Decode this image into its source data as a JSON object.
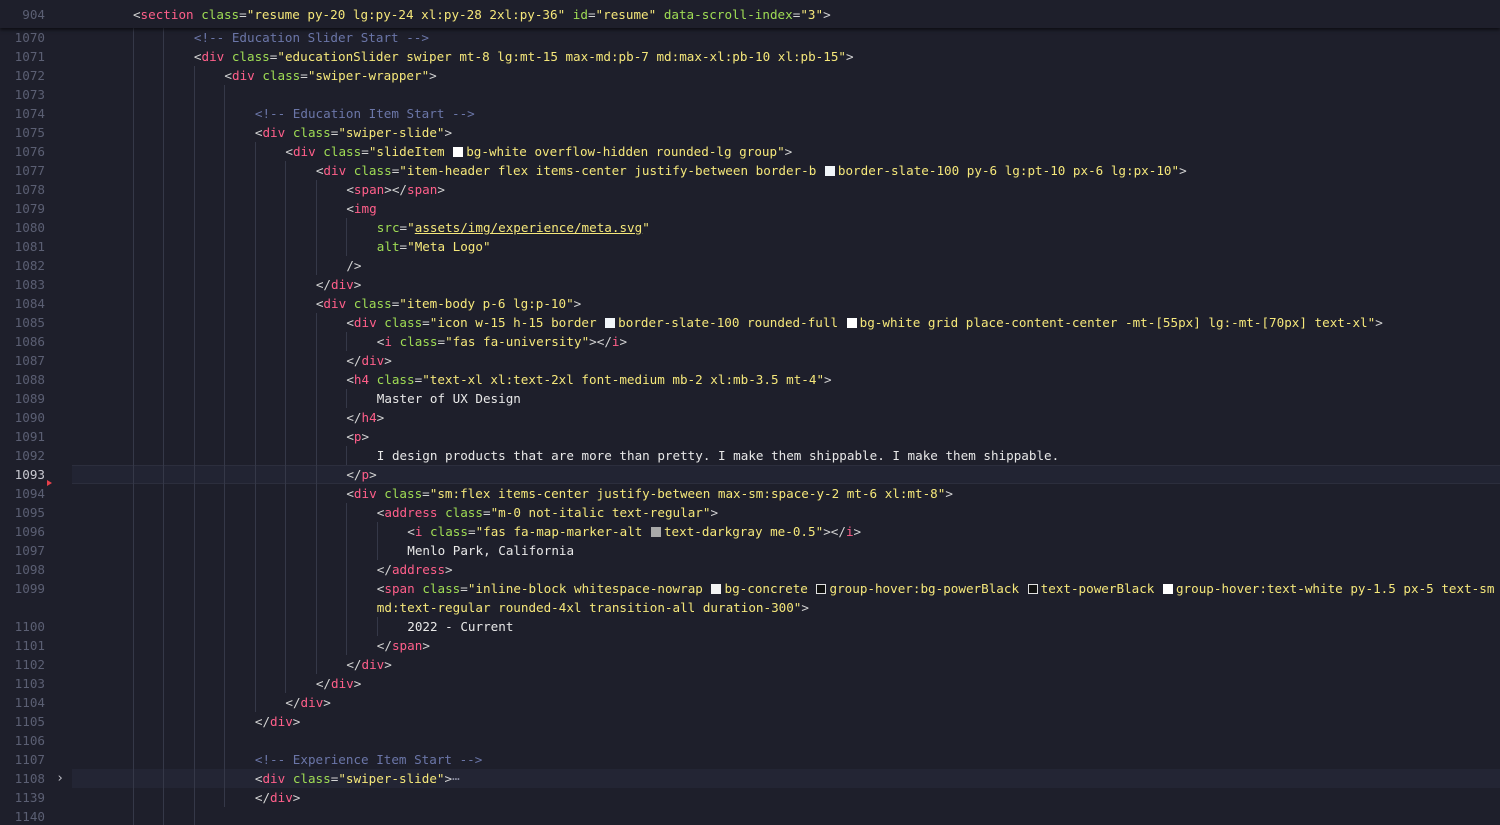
{
  "editor": {
    "sticky": {
      "line_number": "904",
      "code": [
        {
          "k": "p",
          "v": "<"
        },
        {
          "k": "t",
          "v": "section"
        },
        {
          "k": "p",
          "v": " "
        },
        {
          "k": "a",
          "v": "class"
        },
        {
          "k": "p",
          "v": "="
        },
        {
          "k": "s",
          "v": "\"resume py-20 lg:py-24 xl:py-28 2xl:py-36\""
        },
        {
          "k": "p",
          "v": " "
        },
        {
          "k": "a",
          "v": "id"
        },
        {
          "k": "p",
          "v": "="
        },
        {
          "k": "s",
          "v": "\"resume\""
        },
        {
          "k": "p",
          "v": " "
        },
        {
          "k": "a",
          "v": "data-scroll-index"
        },
        {
          "k": "p",
          "v": "="
        },
        {
          "k": "s",
          "v": "\"3\""
        },
        {
          "k": "p",
          "v": ">"
        }
      ]
    },
    "lines": [
      {
        "ln": "1070",
        "indent": 4,
        "code": [
          {
            "k": "c",
            "v": "<!-- Education Slider Start -->"
          }
        ]
      },
      {
        "ln": "1071",
        "indent": 4,
        "code": [
          {
            "k": "p",
            "v": "<"
          },
          {
            "k": "t",
            "v": "div"
          },
          {
            "k": "p",
            "v": " "
          },
          {
            "k": "a",
            "v": "class"
          },
          {
            "k": "p",
            "v": "="
          },
          {
            "k": "s",
            "v": "\"educationSlider swiper mt-8 lg:mt-15 max-md:pb-7 md:max-xl:pb-10 xl:pb-15\""
          },
          {
            "k": "p",
            "v": ">"
          }
        ]
      },
      {
        "ln": "1072",
        "indent": 5,
        "code": [
          {
            "k": "p",
            "v": "<"
          },
          {
            "k": "t",
            "v": "div"
          },
          {
            "k": "p",
            "v": " "
          },
          {
            "k": "a",
            "v": "class"
          },
          {
            "k": "p",
            "v": "="
          },
          {
            "k": "s",
            "v": "\"swiper-wrapper\""
          },
          {
            "k": "p",
            "v": ">"
          }
        ]
      },
      {
        "ln": "1073",
        "indent": 6,
        "code": []
      },
      {
        "ln": "1074",
        "indent": 6,
        "code": [
          {
            "k": "c",
            "v": "<!-- Education Item Start -->"
          }
        ]
      },
      {
        "ln": "1075",
        "indent": 6,
        "code": [
          {
            "k": "p",
            "v": "<"
          },
          {
            "k": "t",
            "v": "div"
          },
          {
            "k": "p",
            "v": " "
          },
          {
            "k": "a",
            "v": "class"
          },
          {
            "k": "p",
            "v": "="
          },
          {
            "k": "s",
            "v": "\"swiper-slide\""
          },
          {
            "k": "p",
            "v": ">"
          }
        ]
      },
      {
        "ln": "1076",
        "indent": 7,
        "code": [
          {
            "k": "p",
            "v": "<"
          },
          {
            "k": "t",
            "v": "div"
          },
          {
            "k": "p",
            "v": " "
          },
          {
            "k": "a",
            "v": "class"
          },
          {
            "k": "p",
            "v": "="
          },
          {
            "k": "s",
            "v": "\"slideItem "
          },
          {
            "k": "sw",
            "v": "white"
          },
          {
            "k": "s",
            "v": "bg-white overflow-hidden rounded-lg group\""
          },
          {
            "k": "p",
            "v": ">"
          }
        ]
      },
      {
        "ln": "1077",
        "indent": 8,
        "code": [
          {
            "k": "p",
            "v": "<"
          },
          {
            "k": "t",
            "v": "div"
          },
          {
            "k": "p",
            "v": " "
          },
          {
            "k": "a",
            "v": "class"
          },
          {
            "k": "p",
            "v": "="
          },
          {
            "k": "s",
            "v": "\"item-header flex items-center justify-between border-b "
          },
          {
            "k": "sw",
            "v": "slate"
          },
          {
            "k": "s",
            "v": "border-slate-100 py-6 lg:pt-10 px-6 lg:px-10\""
          },
          {
            "k": "p",
            "v": ">"
          }
        ]
      },
      {
        "ln": "1078",
        "indent": 9,
        "code": [
          {
            "k": "p",
            "v": "<"
          },
          {
            "k": "t",
            "v": "span"
          },
          {
            "k": "p",
            "v": "></"
          },
          {
            "k": "t",
            "v": "span"
          },
          {
            "k": "p",
            "v": ">"
          }
        ]
      },
      {
        "ln": "1079",
        "indent": 9,
        "code": [
          {
            "k": "p",
            "v": "<"
          },
          {
            "k": "t",
            "v": "img"
          }
        ]
      },
      {
        "ln": "1080",
        "indent": 10,
        "code": [
          {
            "k": "a",
            "v": "src"
          },
          {
            "k": "p",
            "v": "="
          },
          {
            "k": "s",
            "v": "\""
          },
          {
            "k": "u",
            "v": "assets/img/experience/meta.svg"
          },
          {
            "k": "s",
            "v": "\""
          }
        ]
      },
      {
        "ln": "1081",
        "indent": 10,
        "code": [
          {
            "k": "a",
            "v": "alt"
          },
          {
            "k": "p",
            "v": "="
          },
          {
            "k": "s",
            "v": "\"Meta Logo\""
          }
        ]
      },
      {
        "ln": "1082",
        "indent": 9,
        "code": [
          {
            "k": "p",
            "v": "/>"
          }
        ]
      },
      {
        "ln": "1083",
        "indent": 8,
        "code": [
          {
            "k": "p",
            "v": "</"
          },
          {
            "k": "t",
            "v": "div"
          },
          {
            "k": "p",
            "v": ">"
          }
        ]
      },
      {
        "ln": "1084",
        "indent": 8,
        "code": [
          {
            "k": "p",
            "v": "<"
          },
          {
            "k": "t",
            "v": "div"
          },
          {
            "k": "p",
            "v": " "
          },
          {
            "k": "a",
            "v": "class"
          },
          {
            "k": "p",
            "v": "="
          },
          {
            "k": "s",
            "v": "\"item-body p-6 lg:p-10\""
          },
          {
            "k": "p",
            "v": ">"
          }
        ]
      },
      {
        "ln": "1085",
        "indent": 9,
        "code": [
          {
            "k": "p",
            "v": "<"
          },
          {
            "k": "t",
            "v": "div"
          },
          {
            "k": "p",
            "v": " "
          },
          {
            "k": "a",
            "v": "class"
          },
          {
            "k": "p",
            "v": "="
          },
          {
            "k": "s",
            "v": "\"icon w-15 h-15 border "
          },
          {
            "k": "sw",
            "v": "slate"
          },
          {
            "k": "s",
            "v": "border-slate-100 rounded-full "
          },
          {
            "k": "sw",
            "v": "white"
          },
          {
            "k": "s",
            "v": "bg-white grid place-content-center -mt-[55px] lg:-mt-[70px] text-xl\""
          },
          {
            "k": "p",
            "v": ">"
          }
        ]
      },
      {
        "ln": "1086",
        "indent": 10,
        "code": [
          {
            "k": "p",
            "v": "<"
          },
          {
            "k": "t",
            "v": "i"
          },
          {
            "k": "p",
            "v": " "
          },
          {
            "k": "a",
            "v": "class"
          },
          {
            "k": "p",
            "v": "="
          },
          {
            "k": "s",
            "v": "\"fas fa-university\""
          },
          {
            "k": "p",
            "v": "></"
          },
          {
            "k": "t",
            "v": "i"
          },
          {
            "k": "p",
            "v": ">"
          }
        ]
      },
      {
        "ln": "1087",
        "indent": 9,
        "code": [
          {
            "k": "p",
            "v": "</"
          },
          {
            "k": "t",
            "v": "div"
          },
          {
            "k": "p",
            "v": ">"
          }
        ]
      },
      {
        "ln": "1088",
        "indent": 9,
        "code": [
          {
            "k": "p",
            "v": "<"
          },
          {
            "k": "t",
            "v": "h4"
          },
          {
            "k": "p",
            "v": " "
          },
          {
            "k": "a",
            "v": "class"
          },
          {
            "k": "p",
            "v": "="
          },
          {
            "k": "s",
            "v": "\"text-xl xl:text-2xl font-medium mb-2 xl:mb-3.5 mt-4\""
          },
          {
            "k": "p",
            "v": ">"
          }
        ]
      },
      {
        "ln": "1089",
        "indent": 10,
        "code": [
          {
            "k": "tx",
            "v": "Master of UX Design"
          }
        ]
      },
      {
        "ln": "1090",
        "indent": 9,
        "code": [
          {
            "k": "p",
            "v": "</"
          },
          {
            "k": "t",
            "v": "h4"
          },
          {
            "k": "p",
            "v": ">"
          }
        ]
      },
      {
        "ln": "1091",
        "indent": 9,
        "code": [
          {
            "k": "p",
            "v": "<"
          },
          {
            "k": "t",
            "v": "p"
          },
          {
            "k": "p",
            "v": ">"
          }
        ]
      },
      {
        "ln": "1092",
        "indent": 10,
        "code": [
          {
            "k": "tx",
            "v": "I design products that are more than pretty. I make them shippable. I make them shippable."
          }
        ]
      },
      {
        "ln": "1093",
        "indent": 9,
        "current": true,
        "code": [
          {
            "k": "p",
            "v": "</"
          },
          {
            "k": "t",
            "v": "p"
          },
          {
            "k": "p",
            "v": ">"
          }
        ]
      },
      {
        "ln": "1094",
        "indent": 9,
        "code": [
          {
            "k": "p",
            "v": "<"
          },
          {
            "k": "t",
            "v": "div"
          },
          {
            "k": "p",
            "v": " "
          },
          {
            "k": "a",
            "v": "class"
          },
          {
            "k": "p",
            "v": "="
          },
          {
            "k": "s",
            "v": "\"sm:flex items-center justify-between max-sm:space-y-2 mt-6 xl:mt-8\""
          },
          {
            "k": "p",
            "v": ">"
          }
        ]
      },
      {
        "ln": "1095",
        "indent": 10,
        "code": [
          {
            "k": "p",
            "v": "<"
          },
          {
            "k": "t",
            "v": "address"
          },
          {
            "k": "p",
            "v": " "
          },
          {
            "k": "a",
            "v": "class"
          },
          {
            "k": "p",
            "v": "="
          },
          {
            "k": "s",
            "v": "\"m-0 not-italic text-regular\""
          },
          {
            "k": "p",
            "v": ">"
          }
        ]
      },
      {
        "ln": "1096",
        "indent": 11,
        "code": [
          {
            "k": "p",
            "v": "<"
          },
          {
            "k": "t",
            "v": "i"
          },
          {
            "k": "p",
            "v": " "
          },
          {
            "k": "a",
            "v": "class"
          },
          {
            "k": "p",
            "v": "="
          },
          {
            "k": "s",
            "v": "\"fas fa-map-marker-alt "
          },
          {
            "k": "sw",
            "v": "gray"
          },
          {
            "k": "s",
            "v": "text-darkgray me-0.5\""
          },
          {
            "k": "p",
            "v": "></"
          },
          {
            "k": "t",
            "v": "i"
          },
          {
            "k": "p",
            "v": ">"
          }
        ]
      },
      {
        "ln": "1097",
        "indent": 11,
        "code": [
          {
            "k": "tx",
            "v": "Menlo Park, California"
          }
        ]
      },
      {
        "ln": "1098",
        "indent": 10,
        "code": [
          {
            "k": "p",
            "v": "</"
          },
          {
            "k": "t",
            "v": "address"
          },
          {
            "k": "p",
            "v": ">"
          }
        ]
      },
      {
        "ln": "1099",
        "indent": 10,
        "code": [
          {
            "k": "p",
            "v": "<"
          },
          {
            "k": "t",
            "v": "span"
          },
          {
            "k": "p",
            "v": " "
          },
          {
            "k": "a",
            "v": "class"
          },
          {
            "k": "p",
            "v": "="
          },
          {
            "k": "s",
            "v": "\"inline-block whitespace-nowrap "
          },
          {
            "k": "sw",
            "v": "concrete"
          },
          {
            "k": "s",
            "v": "bg-concrete "
          },
          {
            "k": "sw",
            "v": "black"
          },
          {
            "k": "s",
            "v": "group-hover:bg-powerBlack "
          },
          {
            "k": "sw",
            "v": "black"
          },
          {
            "k": "s",
            "v": "text-powerBlack "
          },
          {
            "k": "sw",
            "v": "white"
          },
          {
            "k": "s",
            "v": "group-hover:text-white py-1.5 px-5 text-sm"
          }
        ]
      },
      {
        "ln": "",
        "indent": 10,
        "wrap": true,
        "code": [
          {
            "k": "s",
            "v": "md:text-regular rounded-4xl transition-all duration-300\""
          },
          {
            "k": "p",
            "v": ">"
          }
        ]
      },
      {
        "ln": "1100",
        "indent": 11,
        "code": [
          {
            "k": "tx",
            "v": "2022 - Current"
          }
        ]
      },
      {
        "ln": "1101",
        "indent": 10,
        "code": [
          {
            "k": "p",
            "v": "</"
          },
          {
            "k": "t",
            "v": "span"
          },
          {
            "k": "p",
            "v": ">"
          }
        ]
      },
      {
        "ln": "1102",
        "indent": 9,
        "code": [
          {
            "k": "p",
            "v": "</"
          },
          {
            "k": "t",
            "v": "div"
          },
          {
            "k": "p",
            "v": ">"
          }
        ]
      },
      {
        "ln": "1103",
        "indent": 8,
        "code": [
          {
            "k": "p",
            "v": "</"
          },
          {
            "k": "t",
            "v": "div"
          },
          {
            "k": "p",
            "v": ">"
          }
        ]
      },
      {
        "ln": "1104",
        "indent": 7,
        "code": [
          {
            "k": "p",
            "v": "</"
          },
          {
            "k": "t",
            "v": "div"
          },
          {
            "k": "p",
            "v": ">"
          }
        ]
      },
      {
        "ln": "1105",
        "indent": 6,
        "code": [
          {
            "k": "p",
            "v": "</"
          },
          {
            "k": "t",
            "v": "div"
          },
          {
            "k": "p",
            "v": ">"
          }
        ]
      },
      {
        "ln": "1106",
        "indent": 6,
        "code": []
      },
      {
        "ln": "1107",
        "indent": 6,
        "code": [
          {
            "k": "c",
            "v": "<!-- Experience Item Start -->"
          }
        ]
      },
      {
        "ln": "1108",
        "indent": 6,
        "folded": true,
        "code": [
          {
            "k": "p",
            "v": "<"
          },
          {
            "k": "t",
            "v": "div"
          },
          {
            "k": "p",
            "v": " "
          },
          {
            "k": "a",
            "v": "class"
          },
          {
            "k": "p",
            "v": "="
          },
          {
            "k": "s",
            "v": "\"swiper-slide\""
          },
          {
            "k": "p",
            "v": ">"
          },
          {
            "k": "e",
            "v": "⋯"
          }
        ]
      },
      {
        "ln": "1139",
        "indent": 6,
        "code": [
          {
            "k": "p",
            "v": "</"
          },
          {
            "k": "t",
            "v": "div"
          },
          {
            "k": "p",
            "v": ">"
          }
        ]
      },
      {
        "ln": "1140",
        "indent": 5,
        "code": []
      }
    ],
    "active_line": "1093",
    "fold_icon": "chevron-right-icon",
    "colors": {
      "background": "#1e1f2b",
      "tag": "#ff5f8a",
      "attribute": "#9fdc54",
      "string": "#f5e77a",
      "comment": "#6b76a8",
      "text": "#e8e8e8",
      "line_number": "#5b5f73"
    }
  }
}
